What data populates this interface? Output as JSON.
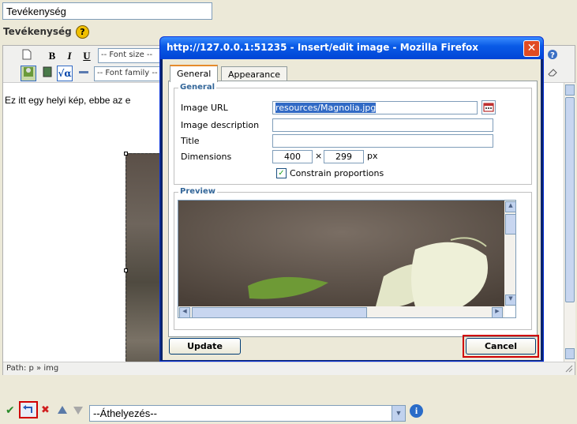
{
  "top": {
    "title_value": "Tevékenység",
    "field_label": "Tevékenység",
    "help_icon_glyph": "?"
  },
  "editor": {
    "toolbar": {
      "bold": "B",
      "italic": "I",
      "underline": "U",
      "font_size_placeholder": "-- Font size --",
      "font_family_placeholder": "-- Font family --",
      "math_glyph": "√α"
    },
    "content_text": "Ez itt egy helyi kép, ebbe az e",
    "status_path": "Path: p » img"
  },
  "dialog": {
    "title": "http://127.0.0.1:51235 - Insert/edit image - Mozilla Firefox",
    "close_glyph": "✕",
    "tabs": [
      "General",
      "Appearance"
    ],
    "general_legend": "General",
    "labels": {
      "image_url": "Image URL",
      "image_description": "Image description",
      "title": "Title",
      "dimensions": "Dimensions",
      "constrain": "Constrain proportions",
      "dim_x": "×",
      "dim_unit": "px"
    },
    "values": {
      "image_url": "resources/Magnolia.jpg",
      "image_description": "",
      "title": "",
      "width": "400",
      "height": "299",
      "constrain_checked": true
    },
    "preview_legend": "Preview",
    "buttons": {
      "update": "Update",
      "cancel": "Cancel"
    }
  },
  "bottom": {
    "move_select_value": "--Áthelyezés--"
  },
  "colors": {
    "titlebar_blue": "#0a5be6",
    "focus_red": "#d00000",
    "legend_blue": "#336699"
  }
}
